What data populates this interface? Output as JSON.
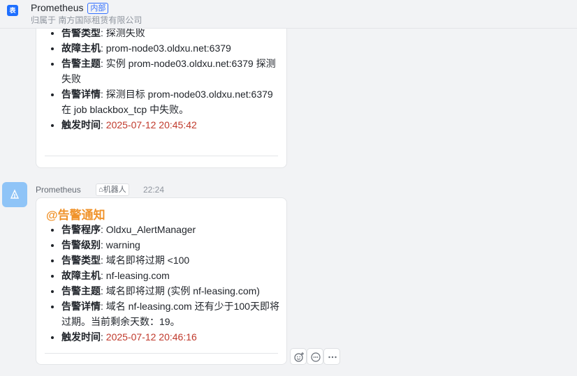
{
  "header": {
    "app_icon_glyph": "表",
    "title": "Prometheus",
    "badge": "内部",
    "subtitle": "归属于 南方国际租赁有限公司"
  },
  "message1": {
    "items": [
      {
        "label": "告警类型",
        "value": "探测失败"
      },
      {
        "label": "故障主机",
        "value": "prom-node03.oldxu.net:6379"
      },
      {
        "label": "告警主题",
        "value": "实例 prom-node03.oldxu.net:6379 探测失败"
      },
      {
        "label": "告警详情",
        "value": "探测目标 prom-node03.oldxu.net:6379 在 job blackbox_tcp 中失败。"
      },
      {
        "label": "触发时间",
        "value": "2025-07-12 20:45:42"
      }
    ]
  },
  "message2": {
    "sender": "Prometheus",
    "bot_tag": "机器人",
    "time": "22:24",
    "title": "@告警通知",
    "items": [
      {
        "label": "告警程序",
        "value": "Oldxu_AlertManager"
      },
      {
        "label": "告警级别",
        "value": "warning"
      },
      {
        "label": "告警类型",
        "value": "域名即将过期 <100"
      },
      {
        "label": "故障主机",
        "value": "nf-leasing.com"
      },
      {
        "label": "告警主题",
        "value": "域名即将过期 (实例 nf-leasing.com)"
      },
      {
        "label": "告警详情",
        "value": "域名 nf-leasing.com 还有少于100天即将过期。当前剩余天数：19。"
      },
      {
        "label": "触发时间",
        "value": "2025-07-12 20:46:16"
      }
    ]
  },
  "colors": {
    "accent": "#3370ff",
    "notify_title": "#f0932b",
    "trigger_time": "#c0392b"
  },
  "icons": [
    "robot-icon",
    "add-reaction-icon",
    "reply-icon",
    "more-icon"
  ],
  "separator": ": "
}
